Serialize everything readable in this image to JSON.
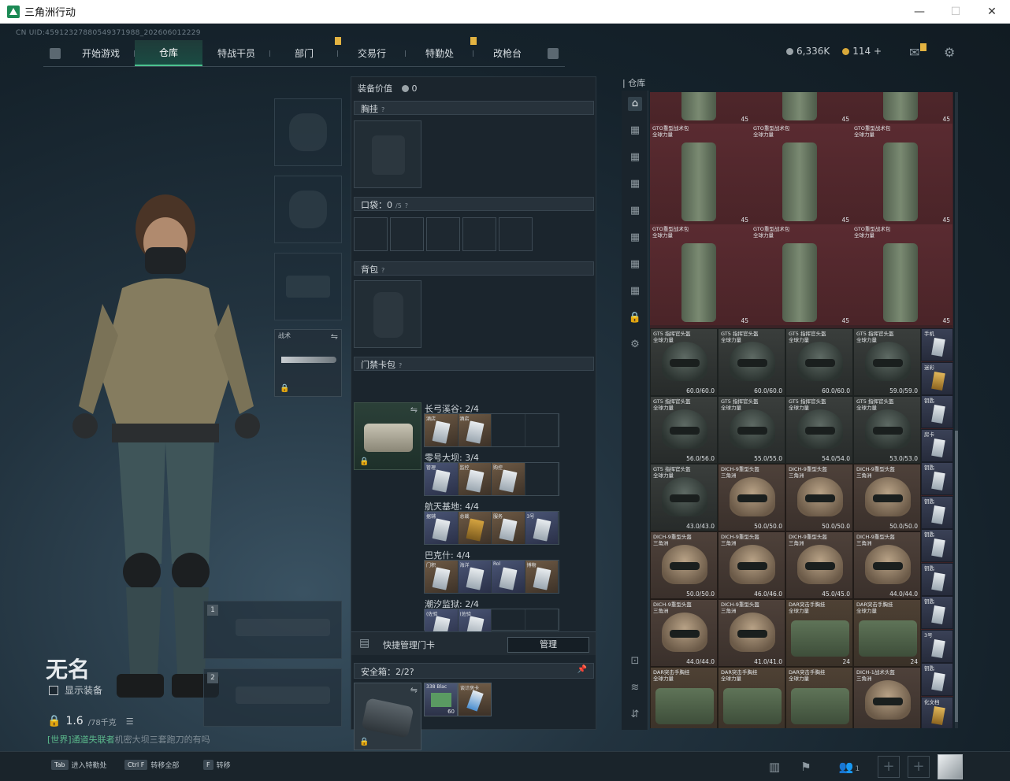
{
  "window": {
    "title": "三角洲行动",
    "minimize": "—",
    "maximize": "☐",
    "close": "✕"
  },
  "uid": "CN UID:45912327880549371988_202606012229",
  "nav": {
    "tabs": [
      {
        "label": "开始游戏",
        "active": false,
        "notice": false
      },
      {
        "label": "仓库",
        "active": true,
        "notice": false
      },
      {
        "label": "特战干员",
        "active": false,
        "notice": false
      },
      {
        "label": "部门",
        "active": false,
        "notice": true
      },
      {
        "label": "交易行",
        "active": false,
        "notice": false
      },
      {
        "label": "特勤处",
        "active": false,
        "notice": true
      },
      {
        "label": "改枪台",
        "active": false,
        "notice": false
      }
    ]
  },
  "currency": {
    "silver": "6,336K",
    "gold": "114 +"
  },
  "character": {
    "name": "无名",
    "show_equipment": "显示装备",
    "weight": "1.6",
    "weight_max": "/78千克",
    "hint_prefix": "[世界]",
    "hint_user": "通道失联者",
    "hint_text": "机密大坝三套跑刀的有吗"
  },
  "slots": {
    "knife_label": "战术",
    "weapon1_num": "1",
    "weapon2_num": "2"
  },
  "middle": {
    "value_label": "装备价值",
    "value": "0",
    "chest_rig": "胸挂",
    "pockets": "口袋：",
    "pockets_count": "0",
    "pockets_max": "/5",
    "backpack": "背包",
    "keycard_bag": "门禁卡包",
    "card_rows": [
      {
        "label": "长弓溪谷: 2/4",
        "cards": [
          {
            "tag": "酒店",
            "style": "brown"
          },
          {
            "tag": "酒店",
            "style": "brown"
          },
          {
            "tag": "",
            "style": "empty"
          },
          {
            "tag": "",
            "style": "empty"
          }
        ]
      },
      {
        "label": "零号大坝: 3/4",
        "cards": [
          {
            "tag": "管理",
            "style": "blue"
          },
          {
            "tag": "监控",
            "style": "brown"
          },
          {
            "tag": "购控",
            "style": "brown"
          },
          {
            "tag": "",
            "style": "empty"
          }
        ]
      },
      {
        "label": "航天基地: 4/4",
        "cards": [
          {
            "tag": "据辅",
            "style": "blue"
          },
          {
            "tag": "总裁",
            "style": "brown"
          },
          {
            "tag": "服务",
            "style": "brown"
          },
          {
            "tag": "3号",
            "style": "blue"
          }
        ]
      },
      {
        "label": "巴克什: 4/4",
        "cards": [
          {
            "tag": "门积",
            "style": "brown"
          },
          {
            "tag": "海洋",
            "style": "blue"
          },
          {
            "tag": "Rol",
            "style": "blue"
          },
          {
            "tag": "博物",
            "style": "brown"
          }
        ]
      },
      {
        "label": "潮汐监狱: 2/4",
        "cards": [
          {
            "tag": "(佐验",
            "style": "blue"
          },
          {
            "tag": "(佐验",
            "style": "blue"
          },
          {
            "tag": "",
            "style": "empty"
          },
          {
            "tag": "",
            "style": "empty"
          }
        ]
      }
    ],
    "quick_manage": "快捷管理门卡",
    "manage_button": "管理",
    "safe_box": "安全箱：",
    "safe_count": "2",
    "safe_max": "/2",
    "safe_items": [
      {
        "tag": "338 Blac",
        "count": "60"
      },
      {
        "tag": "谈计房卡",
        "count": ""
      }
    ]
  },
  "inventory": {
    "title": "仓库",
    "backpack_name": "GTO重型战术包\n全球力量",
    "backpack_count": "45",
    "helmets": [
      {
        "name": "GT5 指挥官头盔\n全球力量",
        "dur": "60.0/60.0",
        "style": "dark"
      },
      {
        "name": "GT5 指挥官头盔\n全球力量",
        "dur": "60.0/60.0",
        "style": "dark"
      },
      {
        "name": "GT5 指挥官头盔\n全球力量",
        "dur": "60.0/60.0",
        "style": "dark"
      },
      {
        "name": "GT5 指挥官头盔\n全球力量",
        "dur": "59.0/59.0",
        "style": "dark"
      },
      {
        "name": "GT5 指挥官头盔\n全球力量",
        "dur": "56.0/56.0",
        "style": "dark"
      },
      {
        "name": "GT5 指挥官头盔\n全球力量",
        "dur": "55.0/55.0",
        "style": "dark"
      },
      {
        "name": "GT5 指挥官头盔\n全球力量",
        "dur": "54.0/54.0",
        "style": "dark"
      },
      {
        "name": "GT5 指挥官头盔\n全球力量",
        "dur": "53.0/53.0",
        "style": "dark"
      },
      {
        "name": "GT5 指挥官头盔\n全球力量",
        "dur": "43.0/43.0",
        "style": "dark"
      },
      {
        "name": "DICH-9重型头盔\n三角洲",
        "dur": "50.0/50.0",
        "style": "tan"
      },
      {
        "name": "DICH-9重型头盔\n三角洲",
        "dur": "50.0/50.0",
        "style": "tan"
      },
      {
        "name": "DICH-9重型头盔\n三角洲",
        "dur": "50.0/50.0",
        "style": "tan"
      },
      {
        "name": "DICH-9重型头盔\n三角洲",
        "dur": "50.0/50.0",
        "style": "tan"
      },
      {
        "name": "DICH-9重型头盔\n三角洲",
        "dur": "46.0/46.0",
        "style": "tan"
      },
      {
        "name": "DICH-9重型头盔\n三角洲",
        "dur": "45.0/45.0",
        "style": "tan"
      },
      {
        "name": "DICH-9重型头盔\n三角洲",
        "dur": "44.0/44.0",
        "style": "tan"
      },
      {
        "name": "DICH-9重型头盔\n三角洲",
        "dur": "44.0/44.0",
        "style": "tan"
      },
      {
        "name": "DICH-9重型头盔\n三角洲",
        "dur": "41.0/41.0",
        "style": "tan"
      }
    ],
    "vests": [
      {
        "name": "DAR突击手胸挂\n全球力量",
        "count": "24"
      },
      {
        "name": "DAR突击手胸挂\n全球力量",
        "count": "24"
      },
      {
        "name": "DAR突击手胸挂\n全球力量",
        "count": ""
      },
      {
        "name": "DAR突击手胸挂\n全球力量",
        "count": ""
      },
      {
        "name": "DAR突击手胸挂\n全球力量",
        "count": ""
      },
      {
        "name": "DICH-1战术头盔\n三角洲",
        "count": ""
      }
    ],
    "side_items": [
      "手机",
      "迷彩",
      "钥匙",
      "房卡",
      "钥匙",
      "钥匙",
      "钥匙",
      "钥匙",
      "钥匙",
      "3号",
      "钥匙",
      "化文档"
    ]
  },
  "bottom": {
    "hints": [
      {
        "key": "Tab",
        "label": "进入特勤处"
      },
      {
        "key": "Ctrl F",
        "label": "转移全部"
      },
      {
        "key": "F",
        "label": "转移"
      }
    ],
    "friends": "1"
  }
}
